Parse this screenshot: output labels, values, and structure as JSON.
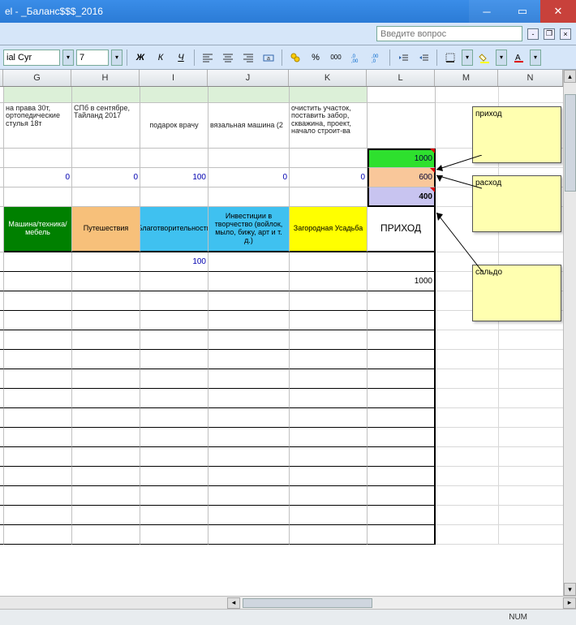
{
  "window": {
    "title": "el - _Баланс$$$_2016"
  },
  "helpbar": {
    "placeholder": "Введите вопрос"
  },
  "toolbar": {
    "font_name": "ial Cyr",
    "font_size": "7",
    "bold": "Ж",
    "italic": "К",
    "underline": "Ч",
    "percent": "%",
    "thousands": "000"
  },
  "columns": {
    "G": "G",
    "H": "H",
    "I": "I",
    "J": "J",
    "K": "K",
    "L": "L",
    "M": "M",
    "N": "N"
  },
  "notes_row": {
    "G": "на права 30т, ортопедические стулья 18т",
    "H": "СПб в сентябре, Тайланд 2017",
    "I": "подарок врачу",
    "J": "вязальная машина (2",
    "K": "очистить участок, поставить забор, скважина, проект, начало строит-ва"
  },
  "totals": {
    "L_green": "1000",
    "row_zeros": {
      "G": "0",
      "H": "0",
      "I": "100",
      "J": "0",
      "K": "0",
      "L": "600"
    },
    "L_bold": "400"
  },
  "categories": {
    "G": "Машина/техника/мебель",
    "H": "Путешествия",
    "I": "Благотворительность",
    "J": "Инвестиции в творчество (войлок, мыло, бижу, арт и т. д.)",
    "K": "Загородная Усадьба",
    "L": "ПРИХОД"
  },
  "data_rows": {
    "r1_I": "100",
    "r2_L": "1000"
  },
  "comments": {
    "c1": "приход",
    "c2": "расход",
    "c3": "сальдо"
  },
  "status": {
    "num": "NUM"
  }
}
